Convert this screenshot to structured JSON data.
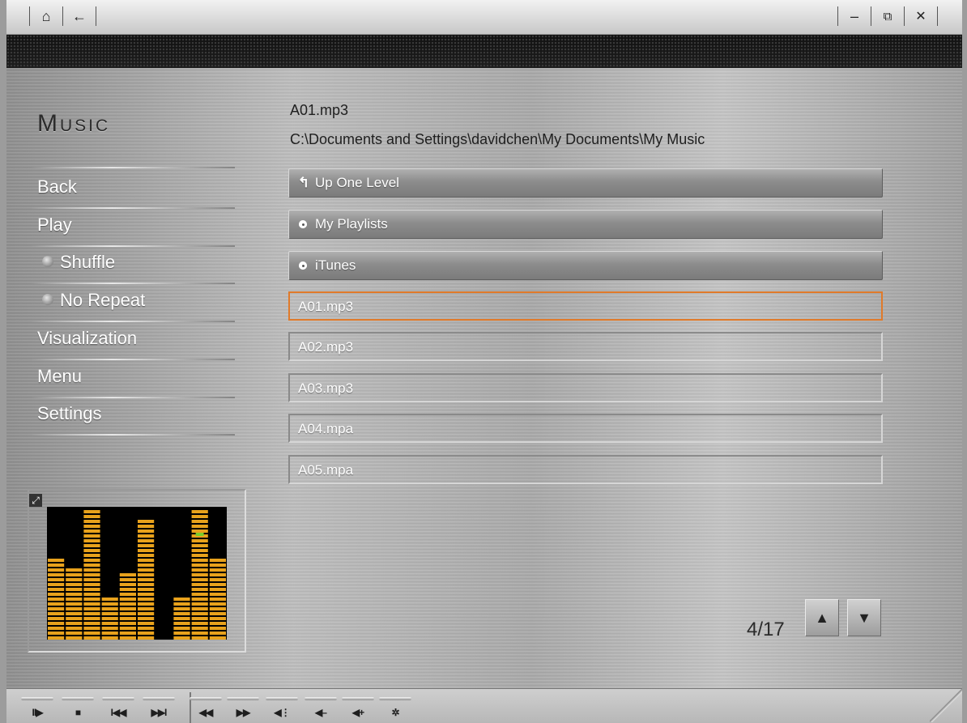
{
  "window": {
    "buttons": {
      "home": "⌂",
      "back": "←",
      "minimize": "–",
      "restore": "⧉",
      "close": "✕"
    }
  },
  "app": {
    "title": "Music"
  },
  "menu": {
    "items": [
      {
        "label": "Back"
      },
      {
        "label": "Play"
      },
      {
        "label": "Shuffle"
      },
      {
        "label": "No Repeat"
      },
      {
        "label": "Visualization"
      },
      {
        "label": "Menu"
      },
      {
        "label": "Settings"
      }
    ]
  },
  "now_playing": {
    "file": "A01.mp3",
    "path": "C:\\Documents and Settings\\davidchen\\My Documents\\My Music"
  },
  "list": {
    "rows": [
      {
        "label": "Up One Level",
        "kind": "up"
      },
      {
        "label": "My Playlists",
        "kind": "folder"
      },
      {
        "label": "iTunes",
        "kind": "folder"
      },
      {
        "label": "A01.mp3",
        "kind": "file",
        "selected": true
      },
      {
        "label": "A02.mp3",
        "kind": "file"
      },
      {
        "label": "A03.mp3",
        "kind": "file"
      },
      {
        "label": "A04.mpa",
        "kind": "file"
      },
      {
        "label": "A05.mpa",
        "kind": "file"
      }
    ]
  },
  "pager": {
    "text": "4/17",
    "up": "▲",
    "down": "▼"
  },
  "visualizer": {
    "levels": [
      0.61,
      0.56,
      1.0,
      0.35,
      0.53,
      0.91,
      0.0,
      0.35,
      1.0,
      0.61
    ],
    "colors": {
      "bar": "#e8a21c",
      "background": "#000000",
      "peak": "#7ccf2a"
    }
  },
  "transport": {
    "buttons": [
      {
        "name": "play-pause",
        "glyph": "II▶"
      },
      {
        "name": "stop",
        "glyph": "■"
      },
      {
        "name": "previous",
        "glyph": "I◀◀"
      },
      {
        "name": "next",
        "glyph": "▶▶I"
      },
      {
        "name": "rewind",
        "glyph": "◀◀"
      },
      {
        "name": "fast-forward",
        "glyph": "▶▶"
      },
      {
        "name": "mute",
        "glyph": "◀⋮"
      },
      {
        "name": "volume-down",
        "glyph": "◀–"
      },
      {
        "name": "volume-up",
        "glyph": "◀+"
      },
      {
        "name": "options",
        "glyph": "✲"
      }
    ]
  },
  "colors": {
    "selection": "#e07a2a",
    "text_light": "#ffffff",
    "text_dark": "#1f1f1f"
  }
}
